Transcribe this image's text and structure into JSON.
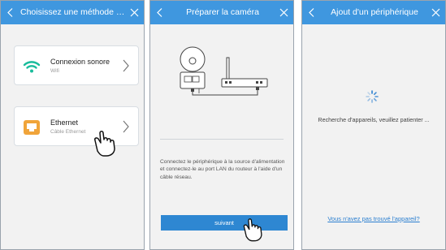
{
  "colors": {
    "header": "#3f97df",
    "button": "#2e87d2",
    "link": "#2b7fd0",
    "wifi": "#1abc9c",
    "ethernet": "#f0a43a"
  },
  "screen1": {
    "title": "Choisissez une méthode de mi...",
    "options": [
      {
        "label": "Connexion sonore",
        "sub": "Wifi",
        "icon": "wifi-icon"
      },
      {
        "label": "Ethernet",
        "sub": "Câble Ethernet",
        "icon": "ethernet-icon"
      }
    ]
  },
  "screen2": {
    "title": "Préparer la caméra",
    "instructions": "Connectez le périphérique à la source d'alimentation et connectez-le au port LAN du routeur à l'aide d'un câble réseau.",
    "next_label": "suivant"
  },
  "screen3": {
    "title": "Ajout d'un périphérique",
    "searching": "Recherche d'appareils, veuillez patienter ...",
    "not_found": "Vous n'avez pas trouvé l'appareil?"
  }
}
